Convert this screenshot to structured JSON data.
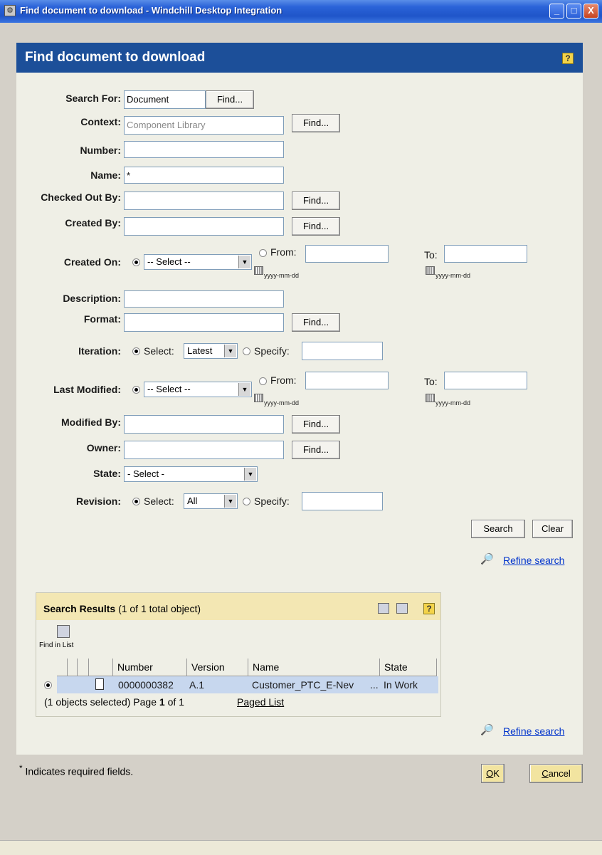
{
  "window": {
    "title": "Find document to download - Windchill Desktop Integration",
    "minimize": "_",
    "maximize": "□",
    "close": "X"
  },
  "header": {
    "title": "Find document to download",
    "help": "?"
  },
  "form": {
    "search_for": {
      "label": "Search For:",
      "value": "Document",
      "button": "Find..."
    },
    "context": {
      "label": "Context:",
      "value": "Component Library",
      "button": "Find..."
    },
    "number": {
      "label": "Number:",
      "value": ""
    },
    "name": {
      "label": "Name:",
      "value": "*"
    },
    "checked_out_by": {
      "label": "Checked Out By:",
      "value": "",
      "button": "Find..."
    },
    "created_by": {
      "label": "Created By:",
      "value": "",
      "button": "Find..."
    },
    "created_on": {
      "label": "Created On:",
      "select": "-- Select --",
      "from_label": "From:",
      "to_label": "To:",
      "date_hint": "yyyy-mm-dd"
    },
    "description": {
      "label": "Description:",
      "value": ""
    },
    "format": {
      "label": "Format:",
      "value": "",
      "button": "Find..."
    },
    "iteration": {
      "label": "Iteration:",
      "select_label": "Select:",
      "select_value": "Latest",
      "specify_label": "Specify:"
    },
    "last_modified": {
      "label": "Last Modified:",
      "select": "-- Select --",
      "from_label": "From:",
      "to_label": "To:",
      "date_hint": "yyyy-mm-dd"
    },
    "modified_by": {
      "label": "Modified By:",
      "value": "",
      "button": "Find..."
    },
    "owner": {
      "label": "Owner:",
      "value": "",
      "button": "Find..."
    },
    "state": {
      "label": "State:",
      "select": "- Select -"
    },
    "revision": {
      "label": "Revision:",
      "select_label": "Select:",
      "select_value": "All",
      "specify_label": "Specify:"
    }
  },
  "actions": {
    "search": "Search",
    "clear": "Clear",
    "refine": "Refine search"
  },
  "results": {
    "title": "Search Results",
    "count": "(1 of 1 total object)",
    "find_in_list": "Find in List",
    "help": "?",
    "columns": [
      "Number",
      "Version",
      "Name",
      "State"
    ],
    "rows": [
      {
        "number": "0000000382",
        "version": "A.1",
        "name": "Customer_PTC_E-Nev",
        "ellipsis": "...",
        "state": "In Work"
      }
    ],
    "footer": {
      "selected": "(1 objects selected)",
      "page_prefix": "Page",
      "page": "1",
      "page_of": "of 1",
      "paged_list": "Paged List"
    }
  },
  "footer": {
    "required_star": "*",
    "required_note": "Indicates required fields.",
    "ok_accel": "O",
    "ok_rest": "K",
    "cancel_accel": "C",
    "cancel_rest": "ancel"
  }
}
